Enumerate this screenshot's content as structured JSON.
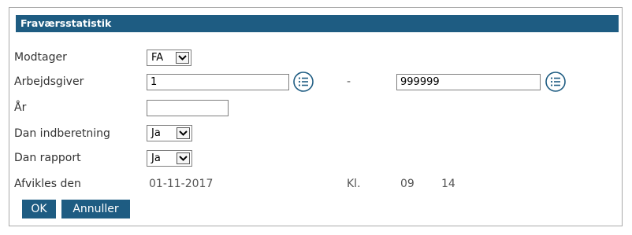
{
  "window": {
    "title": "Fraværsstatistik"
  },
  "form": {
    "modtager": {
      "label": "Modtager",
      "value": "FA"
    },
    "arbejdsgiver": {
      "label": "Arbejdsgiver",
      "from": "1",
      "separator": "-",
      "to": "999999"
    },
    "aar": {
      "label": "År",
      "value": ""
    },
    "dan_indberetning": {
      "label": "Dan indberetning",
      "value": "Ja"
    },
    "dan_rapport": {
      "label": "Dan rapport",
      "value": "Ja"
    },
    "afvikles": {
      "label": "Afvikles den",
      "date": "01-11-2017",
      "kl_label": "Kl.",
      "hour": "09",
      "minute": "14"
    }
  },
  "buttons": {
    "ok": "OK",
    "cancel": "Annuller"
  },
  "colors": {
    "header_bg": "#1e5c82",
    "button_bg": "#1e5c82",
    "icon_color": "#1e5c82"
  },
  "icons": {
    "lookup": "list-lookup-icon",
    "dropdown": "chevron-down-icon"
  }
}
